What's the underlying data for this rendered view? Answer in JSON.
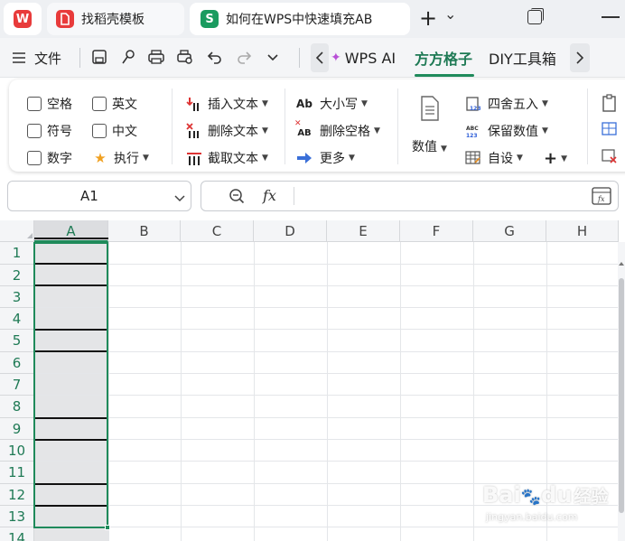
{
  "titlebar": {
    "tabs": [
      {
        "label": "找稻壳模板",
        "icon": "docer-icon"
      },
      {
        "label": "如何在WPS中快速填充AB",
        "icon": "spreadsheet-icon",
        "icon_text": "S"
      }
    ],
    "home_icon_text": "W",
    "new_tab": "+",
    "tab_menu": "⌄"
  },
  "menubar": {
    "file": "文件",
    "tabs": [
      "WPS AI",
      "方方格子",
      "DIY工具箱"
    ],
    "active_tab": "方方格子"
  },
  "ribbon": {
    "checkboxes": [
      "空格",
      "英文",
      "符号",
      "中文",
      "数字"
    ],
    "execute": "执行",
    "text_ops": [
      "插入文本",
      "删除文本",
      "截取文本"
    ],
    "case_ops": [
      "大小写",
      "删除空格",
      "更多"
    ],
    "case_icons": [
      "Ab",
      "AB"
    ],
    "value_btn": "数值",
    "number_ops": [
      "四舍五入",
      "保留数值",
      "自设"
    ],
    "plus": "+"
  },
  "formula_bar": {
    "cell_ref": "A1",
    "fx_label": "fx",
    "value": ""
  },
  "sheet": {
    "columns": [
      "A",
      "B",
      "C",
      "D",
      "E",
      "F",
      "G",
      "H"
    ],
    "rows": [
      "1",
      "2",
      "3",
      "4",
      "5",
      "6",
      "7",
      "8",
      "9",
      "10",
      "11",
      "12",
      "13",
      "14"
    ],
    "selected_column": "A",
    "selection_color": "#1f8a5b"
  },
  "watermark": {
    "text": "Bai",
    "paw": "🐾",
    "text2": "du",
    "suffix": "经验",
    "url": "jingyan.baidu.com"
  }
}
